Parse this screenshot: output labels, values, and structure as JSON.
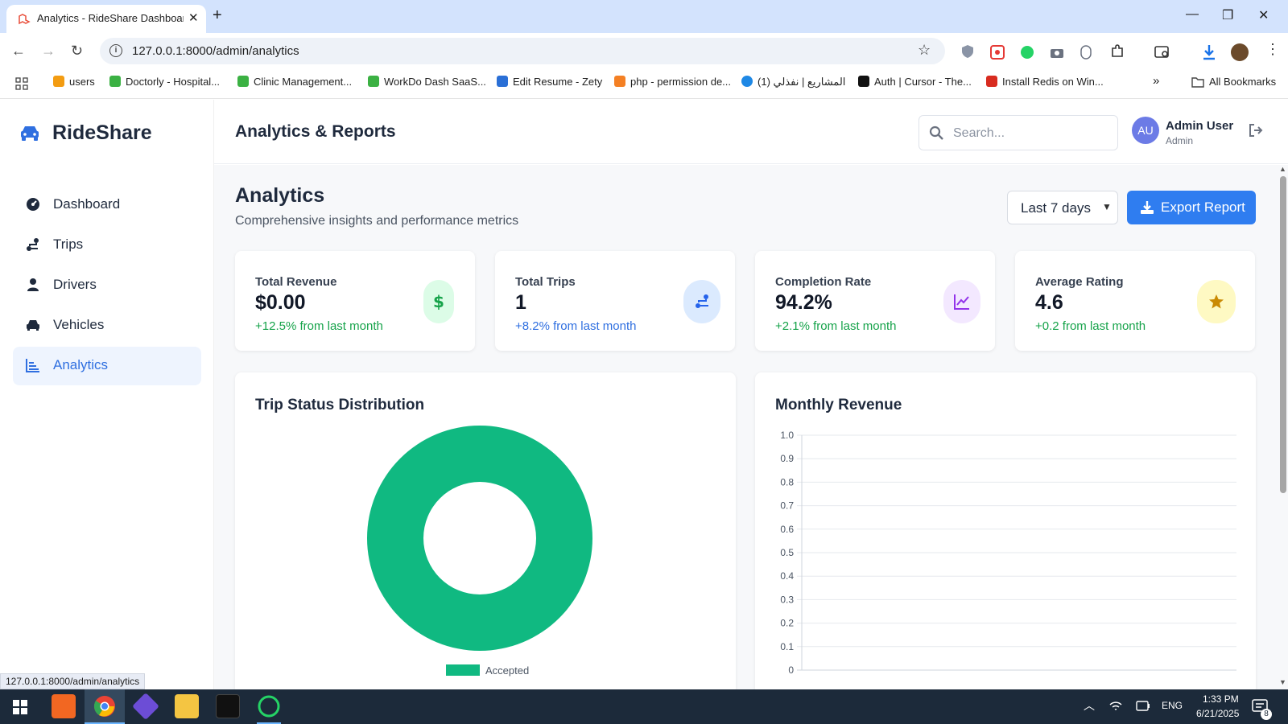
{
  "browser": {
    "tab_title": "Analytics - RideShare Dashboar",
    "url": "127.0.0.1:8000/admin/analytics",
    "status_url": "127.0.0.1:8000/admin/analytics",
    "bookmarks": [
      {
        "label": "users",
        "icon": "pma-icon",
        "color": "#f39c12"
      },
      {
        "label": "Doctorly - Hospital...",
        "icon": "doctorly-icon",
        "color": "#3bb143"
      },
      {
        "label": "Clinic Management...",
        "icon": "clinic-icon",
        "color": "#3bb143"
      },
      {
        "label": "WorkDo Dash SaaS...",
        "icon": "workdo-icon",
        "color": "#3bb143"
      },
      {
        "label": "Edit Resume - Zety",
        "icon": "zety-icon",
        "color": "#2a6fd6"
      },
      {
        "label": "php - permission de...",
        "icon": "stackoverflow-icon",
        "color": "#f48024"
      },
      {
        "label": "المشاريع | نفذلي (1)",
        "icon": "nafezly-icon",
        "color": "#1e88e5"
      },
      {
        "label": "Auth | Cursor - The...",
        "icon": "cursor-icon",
        "color": "#111111"
      },
      {
        "label": "Install Redis on Win...",
        "icon": "redis-icon",
        "color": "#d82c20"
      }
    ],
    "all_bookmarks": "All Bookmarks"
  },
  "app": {
    "brand": "RideShare",
    "page_title": "Analytics & Reports",
    "search_placeholder": "Search...",
    "user": {
      "initials": "AU",
      "name": "Admin User",
      "role": "Admin"
    },
    "nav": [
      {
        "label": "Dashboard",
        "icon": "dashboard-icon",
        "active": false
      },
      {
        "label": "Trips",
        "icon": "route-icon",
        "active": false
      },
      {
        "label": "Drivers",
        "icon": "user-icon",
        "active": false
      },
      {
        "label": "Vehicles",
        "icon": "car-icon",
        "active": false
      },
      {
        "label": "Analytics",
        "icon": "chart-bar-icon",
        "active": true
      }
    ]
  },
  "main": {
    "heading": "Analytics",
    "subtitle": "Comprehensive insights and performance metrics",
    "range": "Last 7 days",
    "export_label": "Export Report",
    "cards": [
      {
        "label": "Total Revenue",
        "value": "$0.00",
        "change": "+12.5% from last month",
        "change_color": "#16a34a",
        "icon": "dollar-icon",
        "icon_bg": "#dcfce7",
        "icon_color": "#16a34a"
      },
      {
        "label": "Total Trips",
        "value": "1",
        "change": "+8.2% from last month",
        "change_color": "#2f6fe0",
        "icon": "route-icon",
        "icon_bg": "#dbeafe",
        "icon_color": "#2563eb"
      },
      {
        "label": "Completion Rate",
        "value": "94.2%",
        "change": "+2.1% from last month",
        "change_color": "#16a34a",
        "icon": "chart-line-icon",
        "icon_bg": "#f3e8ff",
        "icon_color": "#9333ea"
      },
      {
        "label": "Average Rating",
        "value": "4.6",
        "change": "+0.2 from last month",
        "change_color": "#16a34a",
        "icon": "star-icon",
        "icon_bg": "#fef9c3",
        "icon_color": "#ca8a04"
      }
    ],
    "panels": {
      "status_title": "Trip Status Distribution",
      "revenue_title": "Monthly Revenue"
    }
  },
  "chart_data": [
    {
      "type": "pie",
      "title": "Trip Status Distribution",
      "categories": [
        "Accepted"
      ],
      "values": [
        1
      ],
      "colors": [
        "#10b981"
      ],
      "legend": "bottom"
    },
    {
      "type": "line",
      "title": "Monthly Revenue",
      "series": [],
      "ylim": [
        0,
        1.0
      ],
      "yticks": [
        "0",
        "0.1",
        "0.2",
        "0.3",
        "0.4",
        "0.5",
        "0.6",
        "0.7",
        "0.8",
        "0.9",
        "1.0"
      ],
      "grid": true
    }
  ],
  "taskbar": {
    "lang": "ENG",
    "time": "1:33 PM",
    "date": "6/21/2025",
    "notifications": "8"
  }
}
